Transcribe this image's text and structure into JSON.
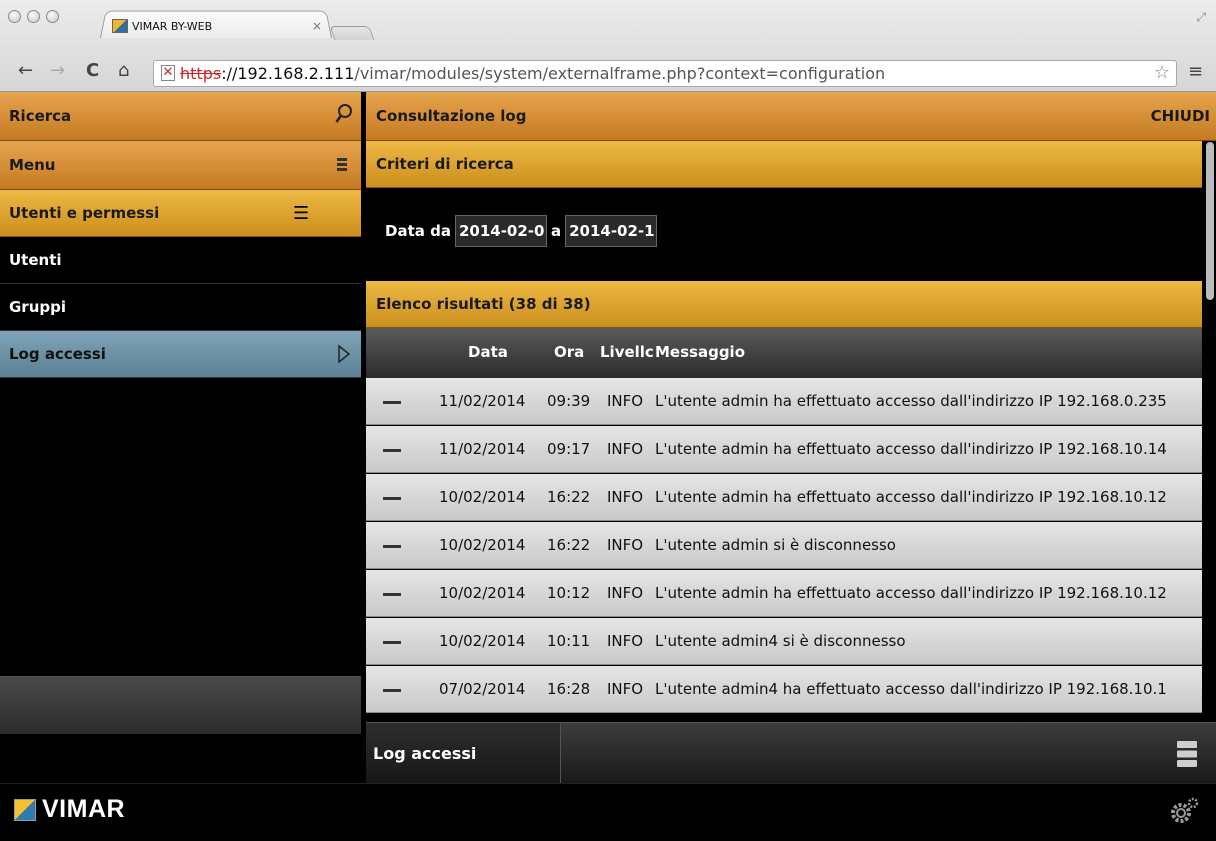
{
  "browser": {
    "tab_title": "VIMAR BY-WEB",
    "tab_close": "×",
    "url_scheme": "https",
    "url_host": "://192.168.2.111",
    "url_path": "/vimar/modules/system/externalframe.php?context=configuration",
    "back": "←",
    "forward": "→",
    "reload": "C",
    "home": "⌂",
    "star": "☆",
    "menu": "≡"
  },
  "sidebar": {
    "search_label": "Ricerca",
    "menu_label": "Menu",
    "section_label": "Utenti e permessi",
    "items": [
      {
        "label": "Utenti"
      },
      {
        "label": "Gruppi"
      },
      {
        "label": "Log accessi"
      }
    ]
  },
  "main": {
    "title": "Consultazione log",
    "close_label": "CHIUDI",
    "criteria_title": "Criteri di ricerca",
    "date_from_label": "Data da",
    "date_from_value": "2014-02-0",
    "date_to_label": "a",
    "date_to_value": "2014-02-1",
    "results_title": "Elenco risultati (38 di 38)",
    "columns": {
      "date": "Data",
      "time": "Ora",
      "level": "Livellc",
      "message": "Messaggio"
    },
    "rows": [
      {
        "date": "11/02/2014",
        "time": "09:39",
        "level": "INFO",
        "message": "L'utente admin ha effettuato accesso dall'indirizzo IP 192.168.0.235"
      },
      {
        "date": "11/02/2014",
        "time": "09:17",
        "level": "INFO",
        "message": "L'utente admin ha effettuato accesso dall'indirizzo IP 192.168.10.14"
      },
      {
        "date": "10/02/2014",
        "time": "16:22",
        "level": "INFO",
        "message": "L'utente admin ha effettuato accesso dall'indirizzo IP 192.168.10.12"
      },
      {
        "date": "10/02/2014",
        "time": "16:22",
        "level": "INFO",
        "message": "L'utente admin si è disconnesso"
      },
      {
        "date": "10/02/2014",
        "time": "10:12",
        "level": "INFO",
        "message": "L'utente admin ha effettuato accesso dall'indirizzo IP 192.168.10.12"
      },
      {
        "date": "10/02/2014",
        "time": "10:11",
        "level": "INFO",
        "message": "L'utente admin4 si è disconnesso"
      },
      {
        "date": "07/02/2014",
        "time": "16:28",
        "level": "INFO",
        "message": "L'utente admin4 ha effettuato accesso dall'indirizzo IP 192.168.10.1"
      }
    ],
    "footer_tab": "Log accessi"
  },
  "brand": {
    "name": "VIMAR"
  },
  "colors": {
    "accent_orange": "#d98e35",
    "accent_gold": "#e0a732",
    "selected_blue": "#6d92a6"
  }
}
